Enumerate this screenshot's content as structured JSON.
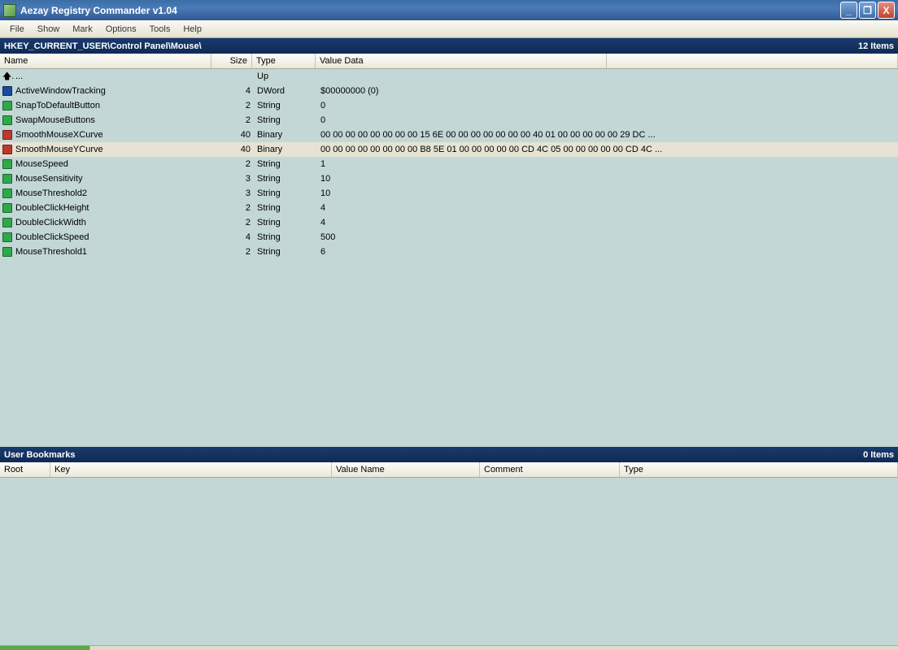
{
  "titlebar": {
    "title": "Aezay Registry Commander v1.04"
  },
  "menu": [
    "File",
    "Show",
    "Mark",
    "Options",
    "Tools",
    "Help"
  ],
  "path": {
    "text": "HKEY_CURRENT_USER\\Control Panel\\Mouse\\",
    "count": "12 Items"
  },
  "columns": {
    "name": "Name",
    "size": "Size",
    "type": "Type",
    "value": "Value Data"
  },
  "rows": [
    {
      "icon": "up",
      "name": "...",
      "size": "",
      "type": "Up",
      "value": ""
    },
    {
      "icon": "dword",
      "name": "ActiveWindowTracking",
      "size": "4",
      "type": "DWord",
      "value": "$00000000  (0)"
    },
    {
      "icon": "string",
      "name": "SnapToDefaultButton",
      "size": "2",
      "type": "String",
      "value": "0"
    },
    {
      "icon": "string",
      "name": "SwapMouseButtons",
      "size": "2",
      "type": "String",
      "value": "0"
    },
    {
      "icon": "binary",
      "name": "SmoothMouseXCurve",
      "size": "40",
      "type": "Binary",
      "value": "00 00 00 00 00 00 00 00 15 6E 00 00 00 00 00 00 00 40 01 00 00 00 00 00 29 DC ..."
    },
    {
      "icon": "binary",
      "name": "SmoothMouseYCurve",
      "size": "40",
      "type": "Binary",
      "value": "00 00 00 00 00 00 00 00 B8 5E 01 00 00 00 00 00 CD 4C 05 00 00 00 00 00 CD 4C ...",
      "selected": true
    },
    {
      "icon": "string",
      "name": "MouseSpeed",
      "size": "2",
      "type": "String",
      "value": "1"
    },
    {
      "icon": "string",
      "name": "MouseSensitivity",
      "size": "3",
      "type": "String",
      "value": "10"
    },
    {
      "icon": "string",
      "name": "MouseThreshold2",
      "size": "3",
      "type": "String",
      "value": "10"
    },
    {
      "icon": "string",
      "name": "DoubleClickHeight",
      "size": "2",
      "type": "String",
      "value": "4"
    },
    {
      "icon": "string",
      "name": "DoubleClickWidth",
      "size": "2",
      "type": "String",
      "value": "4"
    },
    {
      "icon": "string",
      "name": "DoubleClickSpeed",
      "size": "4",
      "type": "String",
      "value": "500"
    },
    {
      "icon": "string",
      "name": "MouseThreshold1",
      "size": "2",
      "type": "String",
      "value": "6"
    }
  ],
  "bookmarks": {
    "title": "User Bookmarks",
    "count": "0 Items",
    "cols": {
      "root": "Root",
      "key": "Key",
      "vname": "Value Name",
      "comment": "Comment",
      "type": "Type"
    }
  }
}
